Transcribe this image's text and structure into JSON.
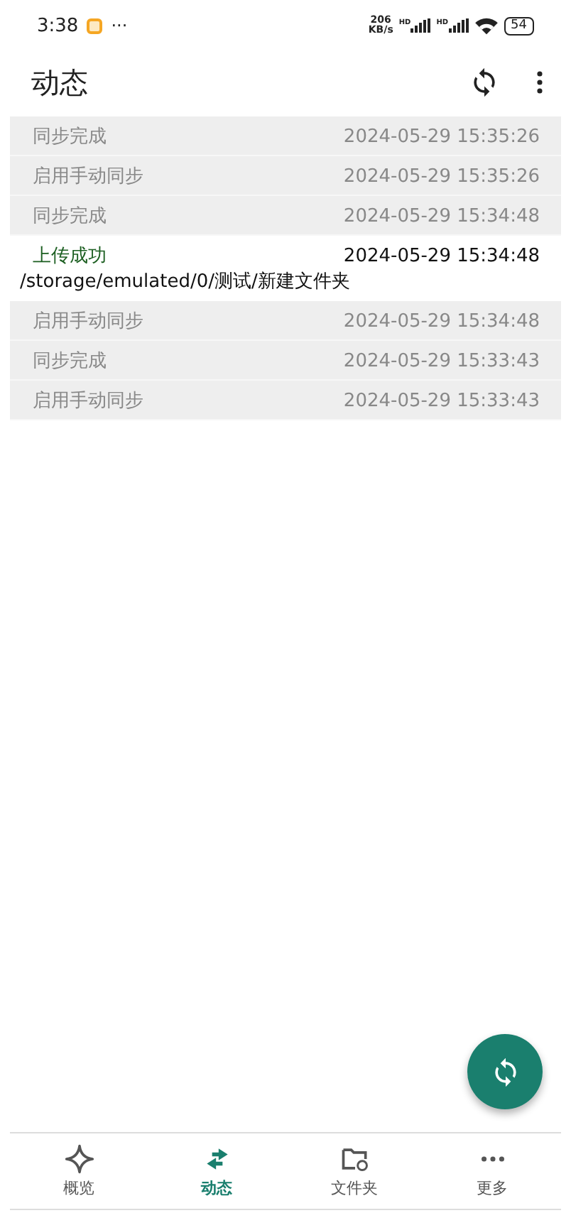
{
  "status_bar": {
    "time": "3:38",
    "more": "···",
    "speed_value": "206",
    "speed_unit": "KB/s",
    "signal_labels": [
      "HD",
      "HD"
    ],
    "battery": "54"
  },
  "app_bar": {
    "title": "动态"
  },
  "events": [
    {
      "kind": "info",
      "title": "同步完成",
      "time": "2024-05-29 15:35:26"
    },
    {
      "kind": "info",
      "title": "启用手动同步",
      "time": "2024-05-29 15:35:26"
    },
    {
      "kind": "info",
      "title": "同步完成",
      "time": "2024-05-29 15:34:48"
    },
    {
      "kind": "success",
      "title": "上传成功",
      "time": "2024-05-29 15:34:48",
      "detail": "/storage/emulated/0/测试/新建文件夹"
    },
    {
      "kind": "info",
      "title": "启用手动同步",
      "time": "2024-05-29 15:34:48"
    },
    {
      "kind": "info",
      "title": "同步完成",
      "time": "2024-05-29 15:33:43"
    },
    {
      "kind": "info",
      "title": "启用手动同步",
      "time": "2024-05-29 15:33:43"
    }
  ],
  "bottom_nav": [
    {
      "label": "概览",
      "selected": false
    },
    {
      "label": "动态",
      "selected": true
    },
    {
      "label": "文件夹",
      "selected": false
    },
    {
      "label": "更多",
      "selected": false
    }
  ]
}
